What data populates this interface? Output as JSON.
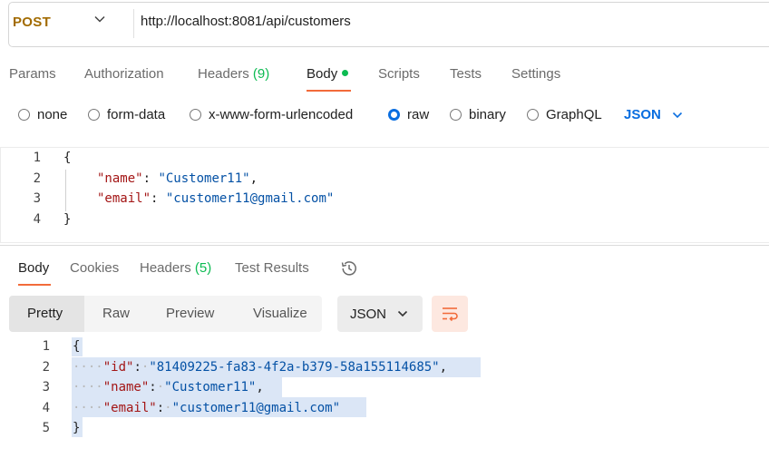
{
  "request": {
    "method": "POST",
    "url": "http://localhost:8081/api/customers"
  },
  "request_tabs": [
    {
      "label": "Params"
    },
    {
      "label": "Authorization"
    },
    {
      "label": "Headers",
      "count": "(9)"
    },
    {
      "label": "Body"
    },
    {
      "label": "Scripts"
    },
    {
      "label": "Tests"
    },
    {
      "label": "Settings"
    }
  ],
  "body_types": [
    {
      "label": "none"
    },
    {
      "label": "form-data"
    },
    {
      "label": "x-www-form-urlencoded"
    },
    {
      "label": "raw",
      "selected": true
    },
    {
      "label": "binary"
    },
    {
      "label": "GraphQL"
    }
  ],
  "raw_format": "JSON",
  "request_body": {
    "line_numbers": [
      "1",
      "2",
      "3",
      "4"
    ],
    "open_brace": "{",
    "close_brace": "}",
    "lines": [
      {
        "key": "\"name\"",
        "colon": ": ",
        "value": "\"Customer11\"",
        "trail": ","
      },
      {
        "key": "\"email\"",
        "colon": ": ",
        "value": "\"customer11@gmail.com\"",
        "trail": ""
      }
    ]
  },
  "response_tabs": [
    {
      "label": "Body"
    },
    {
      "label": "Cookies"
    },
    {
      "label": "Headers",
      "count": "(5)"
    },
    {
      "label": "Test Results"
    }
  ],
  "view_modes": [
    {
      "label": "Pretty"
    },
    {
      "label": "Raw"
    },
    {
      "label": "Preview"
    },
    {
      "label": "Visualize"
    }
  ],
  "response_format": "JSON",
  "response_body": {
    "line_numbers": [
      "1",
      "2",
      "3",
      "4",
      "5"
    ],
    "open_brace": "{",
    "close_brace": "}",
    "lines": [
      {
        "key": "\"id\"",
        "colon": ":",
        "value": "\"81409225-fa83-4f2a-b379-58a155114685\"",
        "trail": ","
      },
      {
        "key": "\"name\"",
        "colon": ":",
        "value": "\"Customer11\"",
        "trail": ","
      },
      {
        "key": "\"email\"",
        "colon": ":",
        "value": "\"customer11@gmail.com\"",
        "trail": ""
      }
    ]
  },
  "icons": {
    "method_dropdown": "chevron-down-icon",
    "format_dropdown": "chevron-down-icon",
    "history": "history-icon",
    "wrap": "wrap-lines-icon"
  },
  "colors": {
    "accent": "#f26b3a",
    "method": "#a26b00",
    "selected": "#0a6ee0",
    "status_dot": "#0cbb52"
  }
}
